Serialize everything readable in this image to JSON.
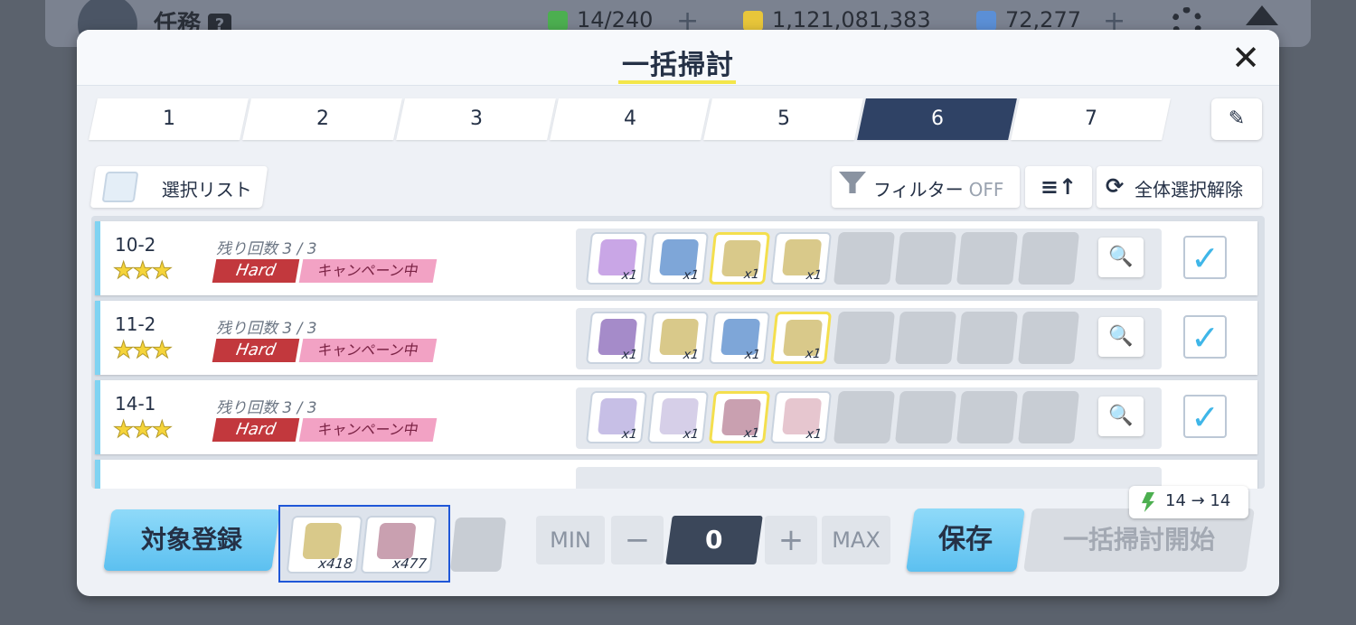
{
  "topbar": {
    "title": "任務",
    "help": "?",
    "ap": "14/240",
    "credits": "1,121,081,383",
    "gems": "72,277"
  },
  "modal": {
    "title": "一括掃討",
    "close": "✕"
  },
  "tabs": [
    "1",
    "2",
    "3",
    "4",
    "5",
    "6",
    "7"
  ],
  "active_tab": "6",
  "toolbar": {
    "select_list": "選択リスト",
    "filter_label": "フィルター",
    "filter_state": "OFF",
    "sort": "≡↑",
    "deselect_all": "全体選択解除"
  },
  "stages": [
    {
      "id": "10-2",
      "remaining": "残り回数 3 / 3",
      "difficulty": "Hard",
      "campaign": "キャンペーン中",
      "stars": "★★★",
      "drops": [
        "x1",
        "x1",
        "x1",
        "x1"
      ],
      "checked": true
    },
    {
      "id": "11-2",
      "remaining": "残り回数 3 / 3",
      "difficulty": "Hard",
      "campaign": "キャンペーン中",
      "stars": "★★★",
      "drops": [
        "x1",
        "x1",
        "x1",
        "x1"
      ],
      "checked": true
    },
    {
      "id": "14-1",
      "remaining": "残り回数 3 / 3",
      "difficulty": "Hard",
      "campaign": "キャンペーン中",
      "stars": "★★★",
      "drops": [
        "x1",
        "x1",
        "x1",
        "x1"
      ],
      "checked": true
    }
  ],
  "bottom": {
    "register": "対象登録",
    "target_items": [
      "x418",
      "x477"
    ],
    "min": "MIN",
    "minus": "−",
    "count": "0",
    "plus": "+",
    "max": "MAX",
    "save": "保存",
    "start": "一括掃討開始",
    "ap_change": "14 → 14"
  },
  "colors": {
    "accent": "#5cc0f0",
    "active_tab": "#2f4265",
    "hard": "#c2383d",
    "campaign": "#f2a2c4",
    "highlight": "#f4df4e"
  }
}
